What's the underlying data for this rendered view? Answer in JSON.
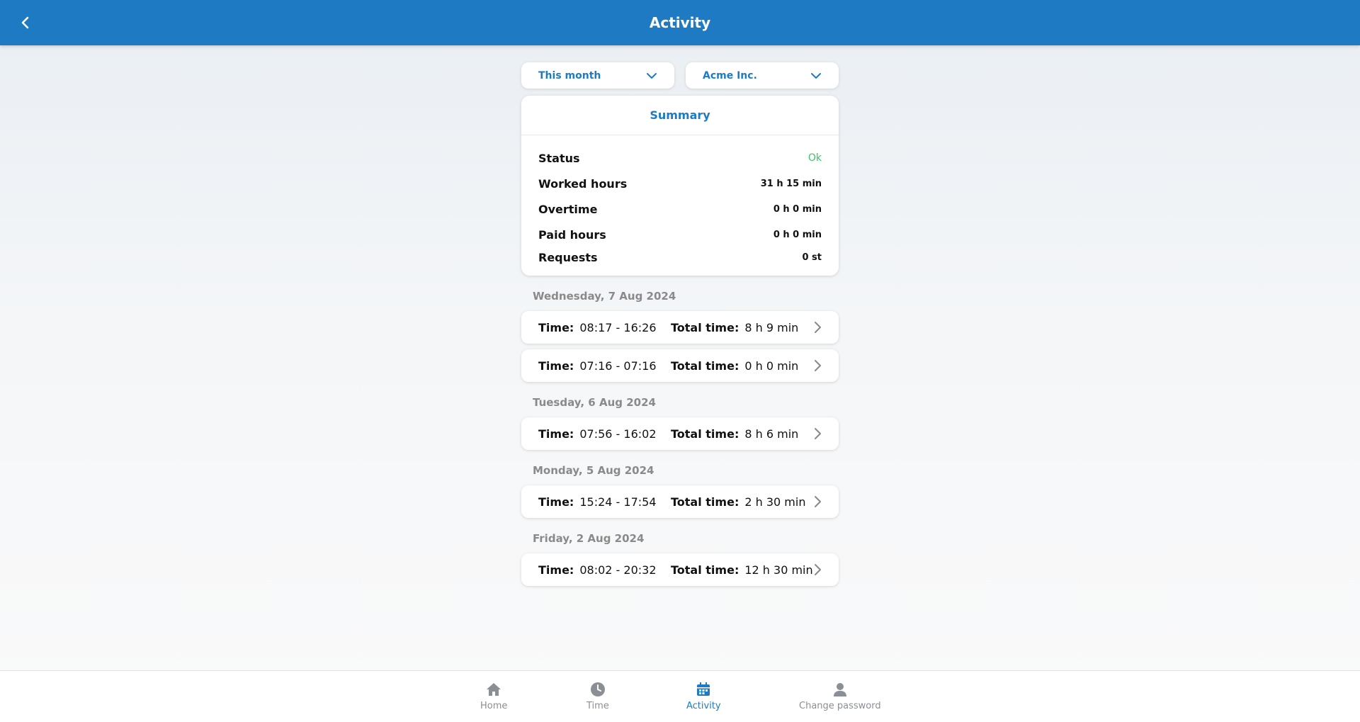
{
  "header": {
    "title": "Activity"
  },
  "filters": {
    "period": "This month",
    "company": "Acme Inc."
  },
  "summary": {
    "title": "Summary",
    "rows": [
      {
        "label": "Status",
        "value": "Ok"
      },
      {
        "label": "Worked hours",
        "value": "31 h 15 min"
      },
      {
        "label": "Overtime",
        "value": "0 h 0 min"
      },
      {
        "label": "Paid hours",
        "value": "0 h 0 min"
      },
      {
        "label": "Requests",
        "value": "0 st"
      }
    ]
  },
  "labels": {
    "time": "Time:",
    "total": "Total time:"
  },
  "days": [
    {
      "date": "Wednesday, 7 Aug 2024",
      "entries": [
        {
          "time": "08:17 - 16:26",
          "total": "8 h 9 min"
        },
        {
          "time": "07:16 - 07:16",
          "total": "0 h 0 min"
        }
      ]
    },
    {
      "date": "Tuesday, 6 Aug 2024",
      "entries": [
        {
          "time": "07:56 - 16:02",
          "total": "8 h 6 min"
        }
      ]
    },
    {
      "date": "Monday, 5 Aug 2024",
      "entries": [
        {
          "time": "15:24 - 17:54",
          "total": "2 h 30 min"
        }
      ]
    },
    {
      "date": "Friday, 2 Aug 2024",
      "entries": [
        {
          "time": "08:02 - 20:32",
          "total": "12 h 30 min"
        }
      ]
    }
  ],
  "nav": {
    "home": "Home",
    "time": "Time",
    "activity": "Activity",
    "change_password": "Change password"
  },
  "colors": {
    "primary": "#1e7bc3",
    "ok": "#3cc46a",
    "muted": "#8a8a8a"
  }
}
